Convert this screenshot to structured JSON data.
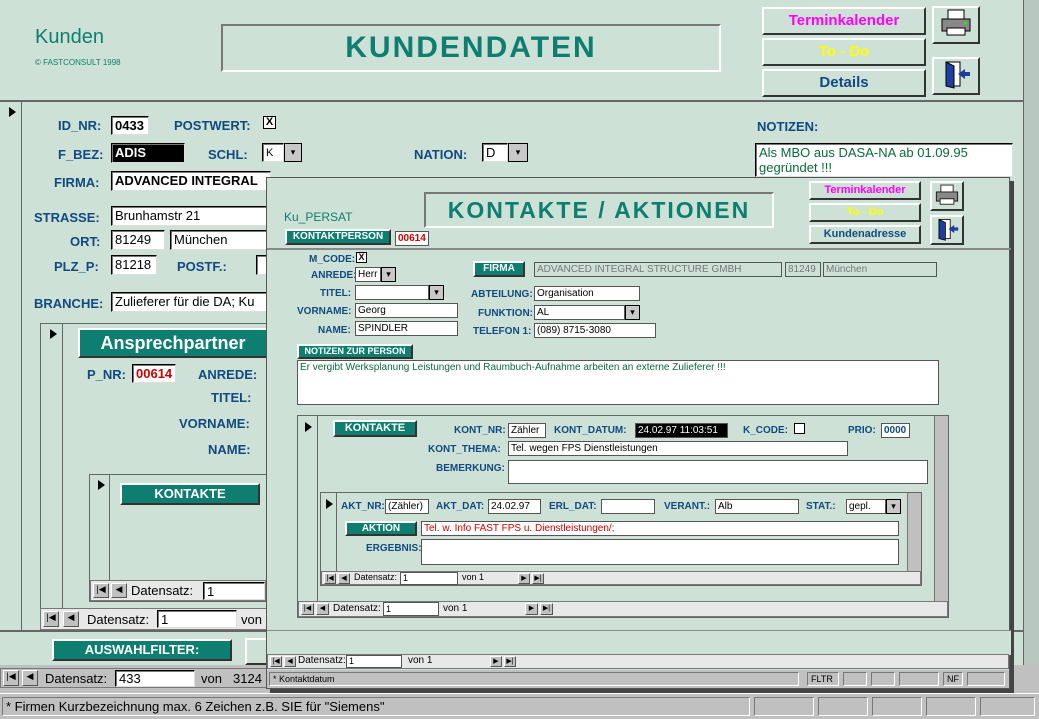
{
  "main": {
    "form_name": "Kunden",
    "copyright": "© FASTCONSULT 1998",
    "title": "KUNDENDATEN",
    "btn_terminkalender": "Terminkalender",
    "btn_todo": "To - Do",
    "btn_details": "Details",
    "notes_label": "NOTIZEN:",
    "notes_text": "Als MBO aus DASA-NA ab 01.09.95 gegründet !!!",
    "id_nr_label": "ID_NR:",
    "id_nr": "0433",
    "postwert_label": "POSTWERT:",
    "postwert_check": "X",
    "f_bez_label": "F_BEZ:",
    "f_bez": "ADIS",
    "schl_label": "SCHL:",
    "schl": "K",
    "nation_label": "NATION:",
    "nation": "D",
    "firma_label": "FIRMA:",
    "firma": "ADVANCED INTEGRAL",
    "strasse_label": "STRASSE:",
    "strasse": "Brunhamstr 21",
    "ort_label": "ORT:",
    "ort_plz": "81249",
    "ort": "München",
    "plz_p_label": "PLZ_P:",
    "plz_p": "81218",
    "postf_label": "POSTF.:",
    "branche_label": "BRANCHE:",
    "branche": "Zulieferer für die DA; Ku",
    "sub": {
      "title": "Ansprechpartner",
      "p_nr_label": "P_NR:",
      "p_nr": "00614",
      "anrede_label": "ANREDE:",
      "titel_label": "TITEL:",
      "vorname_label": "VORNAME:",
      "name_label": "NAME:",
      "kontakte_label": "KONTAKTE",
      "nav_datensatz": "Datensatz:",
      "nav_rec": "1",
      "outer_nav_datensatz": "Datensatz:",
      "outer_nav_rec": "1",
      "outer_nav_von": "von"
    },
    "auswahlfilter": "AUSWAHLFILTER:",
    "nav_datensatz": "Datensatz:",
    "nav_rec": "433",
    "nav_von": "von",
    "nav_total": "3124"
  },
  "popup": {
    "form_name": "Ku_PERSAT",
    "title": "KONTAKTE / AKTIONEN",
    "btn_terminkalender": "Terminkalender",
    "btn_todo": "To - Do",
    "btn_kundenadresse": "Kundenadresse",
    "kontaktperson_label": "KONTAKTPERSON",
    "kontaktperson_nr": "00614",
    "m_code_label": "M_CODE:",
    "m_code_check": "X",
    "anrede_label": "ANREDE:",
    "anrede": "Herr",
    "titel_label": "TITEL:",
    "vorname_label": "VORNAME:",
    "vorname": "Georg",
    "name_label": "NAME:",
    "name": "SPINDLER",
    "firma_label": "FIRMA",
    "firma": "ADVANCED INTEGRAL STRUCTURE GMBH",
    "firma_plz": "81249",
    "firma_ort": "München",
    "abteilung_label": "ABTEILUNG:",
    "abteilung": "Organisation",
    "funktion_label": "FUNKTION:",
    "funktion": "AL",
    "telefon_label": "TELEFON 1:",
    "telefon": "(089) 8715-3080",
    "notizen_label": "NOTIZEN ZUR PERSON",
    "notizen": "Er vergibt Werksplanung Leistungen und Raumbuch-Aufnahme arbeiten an externe Zulieferer !!!",
    "kontakte": {
      "label": "KONTAKTE",
      "kont_nr_label": "KONT_NR:",
      "kont_nr": "Zähler",
      "kont_datum_label": "KONT_DATUM:",
      "kont_datum": "24.02.97 11:03:51",
      "k_code_label": "K_CODE:",
      "prio_label": "PRIO:",
      "prio": "0000",
      "kont_thema_label": "KONT_THEMA:",
      "kont_thema": "Tel. wegen FPS Dienstleistungen",
      "bemerkung_label": "BEMERKUNG:",
      "aktion": {
        "akt_nr_label": "AKT_NR:",
        "akt_nr": "(Zähler)",
        "akt_dat_label": "AKT_DAT:",
        "akt_dat": "24.02.97",
        "erl_dat_label": "ERL_DAT:",
        "verant_label": "VERANT.:",
        "verant": "Alb",
        "stat_label": "STAT.:",
        "stat": "gepl.",
        "aktion_label": "AKTION",
        "aktion_text": "Tel. w. Info FAST FPS u. Dienstleistungen/;",
        "ergebnis_label": "ERGEBNIS:",
        "nav_datensatz": "Datensatz:",
        "nav_rec": "1",
        "nav_von": "von 1"
      },
      "nav_datensatz": "Datensatz:",
      "nav_rec": "1",
      "nav_von": "von 1"
    },
    "nav_datensatz": "Datensatz:",
    "nav_rec": "1",
    "nav_von": "von 1",
    "status_text": "* Kontaktdatum",
    "status_fltr": "FLTR",
    "status_nf": "NF"
  },
  "statusbar": {
    "hint": "* Firmen Kurzbezeichnung max. 6 Zeichen z.B. SIE für \"Siemens\""
  },
  "icons": {
    "printer": "printer-icon",
    "exit": "exit-door-icon",
    "dropdown": "dropdown-arrow-icon",
    "record_selector": "record-selector-triangle-icon"
  },
  "colors": {
    "form_bg": "#cde1d6",
    "teal": "#0d7e70",
    "label_blue": "#114a80",
    "magenta": "#ff00ff",
    "yellow": "#ffff00"
  }
}
